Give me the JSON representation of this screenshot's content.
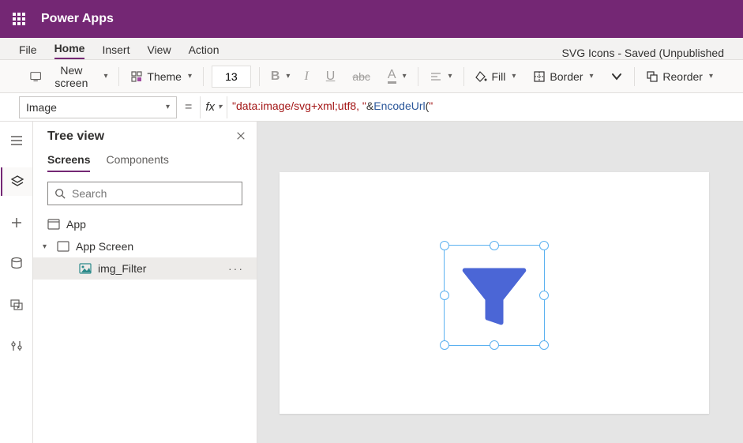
{
  "header": {
    "app_title": "Power Apps"
  },
  "menubar": {
    "items": [
      "File",
      "Home",
      "Insert",
      "View",
      "Action"
    ],
    "active_index": 1,
    "file_status": "SVG Icons - Saved (Unpublished"
  },
  "toolbar": {
    "new_screen_label": "New screen",
    "theme_label": "Theme",
    "font_size": "13",
    "fill_label": "Fill",
    "border_label": "Border",
    "reorder_label": "Reorder"
  },
  "formula_bar": {
    "property_dropdown": "Image",
    "formula_str1": "\"data:image/svg+xml;utf8, \"",
    "formula_op": "&",
    "formula_fn": "EncodeUrl",
    "formula_open": "(",
    "formula_str2": "\""
  },
  "tree_panel": {
    "title": "Tree view",
    "tabs": {
      "screens": "Screens",
      "components": "Components"
    },
    "search_placeholder": "Search",
    "nodes": {
      "app": "App",
      "app_screen": "App Screen",
      "img_filter": "img_Filter"
    }
  },
  "colors": {
    "brand": "#742774",
    "filter_icon": "#4b66d6",
    "selection": "#5bb1f0"
  }
}
